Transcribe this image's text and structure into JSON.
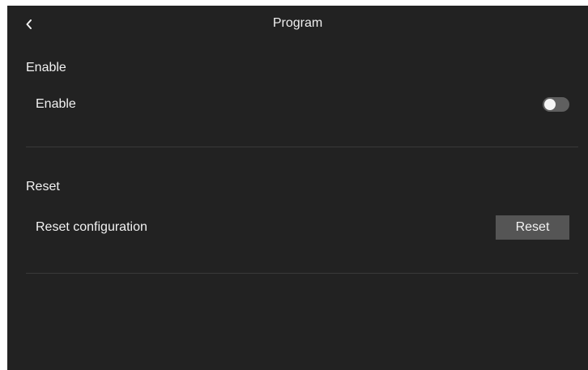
{
  "header": {
    "title": "Program",
    "back_icon": "chevron-left-icon"
  },
  "sections": {
    "enable": {
      "heading": "Enable",
      "row_label": "Enable",
      "toggle_on": false
    },
    "reset": {
      "heading": "Reset",
      "row_label": "Reset configuration",
      "button_label": "Reset"
    }
  },
  "colors": {
    "background": "#222222",
    "text": "#f2f2f2",
    "divider": "#3a3a3a",
    "button": "#555555",
    "toggle_track": "#5f5f5f"
  }
}
